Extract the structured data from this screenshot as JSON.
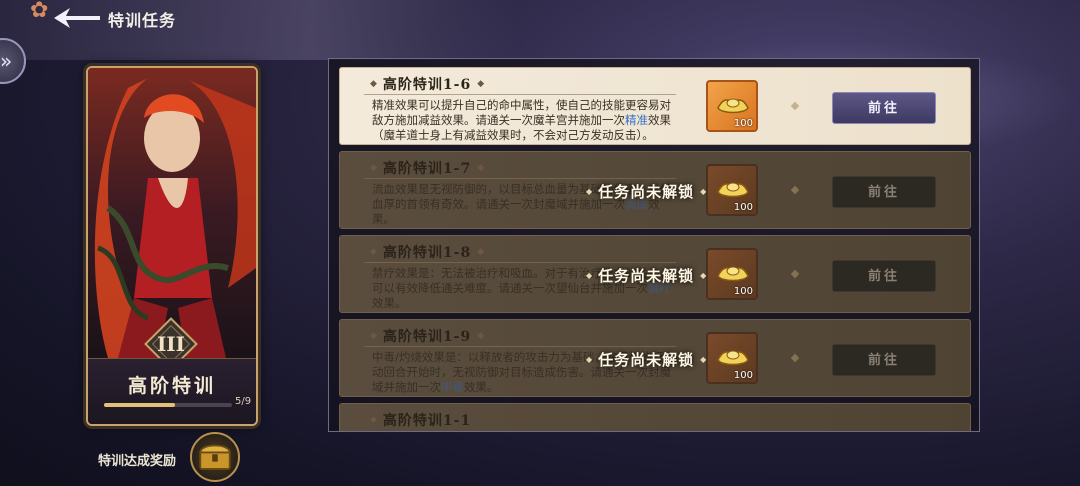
{
  "header": {
    "title": "特训任务"
  },
  "hero": {
    "name": "高阶特训",
    "rank_numeral": "III",
    "progress_text": "5/9",
    "progress_fraction": 0.556
  },
  "reward": {
    "label": "特训达成奖励"
  },
  "tasks": [
    {
      "title": "高阶特训1-6",
      "state": "active",
      "desc_parts": [
        "精准效果可以提升自己的命中属性，使自己的技能更容易对敌方施加减益效果。请通关一次魔羊宫并施加一次",
        "精准",
        "效果（魔羊道士身上有减益效果时，不会对己方发动反击）。"
      ],
      "reward_count": "100",
      "button": "前往"
    },
    {
      "title": "高阶特训1-7",
      "state": "locked",
      "desc_parts": [
        "流血效果是无视防御的，以目标总血量为基础的伤害，对付血厚的首领有奇效。请通关一次封魔域并施加一次",
        "流血",
        "效果。"
      ],
      "reward_count": "100",
      "button": "前往",
      "lock_text": "任务尚未解锁"
    },
    {
      "title": "高阶特训1-8",
      "state": "locked",
      "desc_parts": [
        "禁疗效果是：无法被治疗和吸血。对于有治疗能力的关卡，可以有效降低通关难度。请通关一次望仙台并施加一次",
        "禁疗",
        "效果。"
      ],
      "reward_count": "100",
      "button": "前往",
      "lock_text": "任务尚未解锁"
    },
    {
      "title": "高阶特训1-9",
      "state": "locked",
      "desc_parts": [
        "中毒/灼烧效果是：以释放者的攻击力为基础，在目标的行动回合开始时，无视防御对目标造成伤害。请通关一次封魔域并施加一次",
        "中毒",
        "效果。"
      ],
      "reward_count": "100",
      "button": "前往",
      "lock_text": "任务尚未解锁"
    },
    {
      "title": "高阶特训1-1",
      "state": "peek"
    }
  ]
}
